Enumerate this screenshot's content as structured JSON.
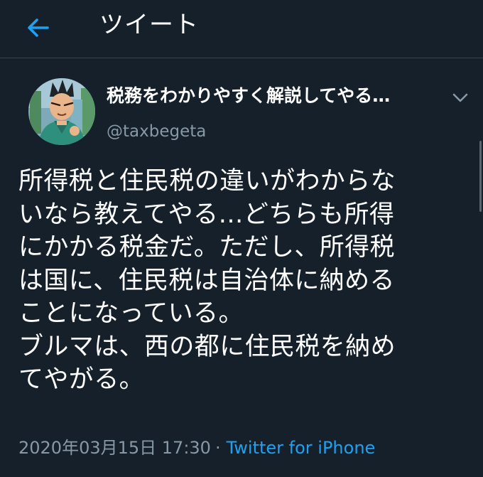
{
  "header": {
    "back_icon": "arrow-left-icon",
    "title": "ツイート"
  },
  "author": {
    "display_name": "税務をわかりやすく解説してやる…",
    "handle": "@taxbegeta",
    "avatar_icon": "user-avatar",
    "more_icon": "chevron-down-icon"
  },
  "tweet": {
    "lines": [
      "所得税と住民税の違いがわからな",
      "いなら教えてやる…どちらも所得",
      "にかかる税金だ。ただし、所得税",
      "は国に、住民税は自治体に納める",
      "ことになっている。",
      "ブルマは、西の都に住民税を納め",
      "てやがる。"
    ],
    "timestamp": "2020年03月15日 17:30",
    "separator": "·",
    "source": "Twitter for iPhone"
  },
  "colors": {
    "background": "#15202b",
    "divider": "#38444d",
    "accent": "#1da1f2",
    "secondary_text": "#8899a6"
  }
}
